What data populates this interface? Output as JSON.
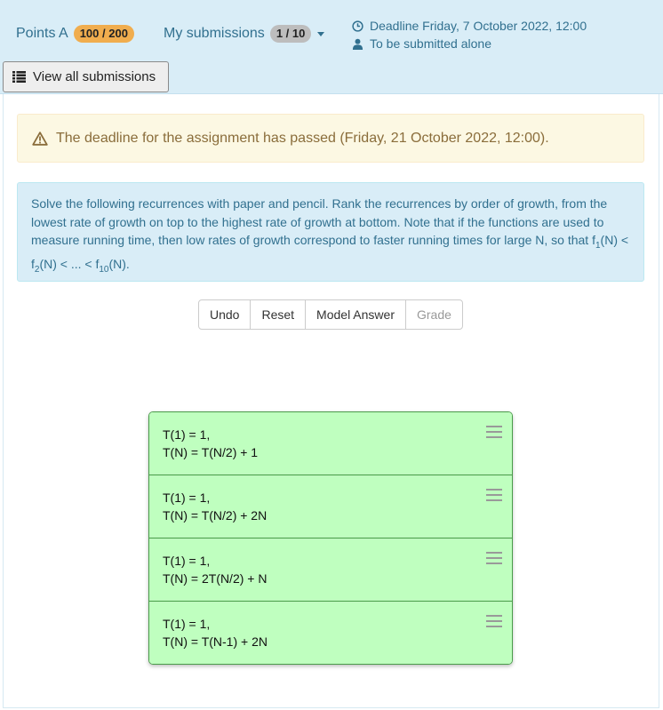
{
  "header": {
    "points_label": "Points A",
    "points_value": "100 / 200",
    "submissions_label": "My submissions",
    "submissions_value": "1 / 10",
    "deadline": "Deadline Friday, 7 October 2022, 12:00",
    "submit_mode": "To be submitted alone",
    "view_all_label": "View all submissions"
  },
  "alert": {
    "text": "The deadline for the assignment has passed (Friday, 21 October 2022, 12:00)."
  },
  "instructions": {
    "text_main": "Solve the following recurrences with paper and pencil. Rank the recurrences by order of growth, from the lowest rate of growth on top to the highest rate of growth at bottom. Note that if the functions are used to measure running time, then low rates of growth correspond to faster running times for large N, so that f",
    "sub1": "1",
    "t1": "(N) < f",
    "sub2": "2",
    "t2": "(N) < ... < f",
    "sub3": "10",
    "t3": "(N)."
  },
  "buttons": {
    "undo": "Undo",
    "reset": "Reset",
    "model_answer": "Model Answer",
    "grade": "Grade"
  },
  "items": [
    {
      "line1": "T(1) = 1,",
      "line2": "T(N) = T(N/2) + 1"
    },
    {
      "line1": "T(1) = 1,",
      "line2": "T(N) = T(N/2) + 2N"
    },
    {
      "line1": "T(1) = 1,",
      "line2": "T(N) = 2T(N/2) + N"
    },
    {
      "line1": "T(1) = 1,",
      "line2": "T(N) = T(N-1) + 2N"
    }
  ],
  "colors": {
    "info_bg": "#d9edf7",
    "warning_bg": "#fcf8e3",
    "item_bg": "#bfffbf",
    "badge_warning": "#f0ad4e"
  }
}
